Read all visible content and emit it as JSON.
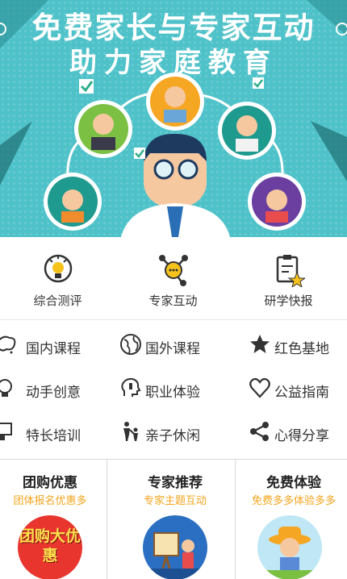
{
  "banner": {
    "title_line1": "免费家长与专家互动",
    "title_line2": "助力家庭教育",
    "colors": {
      "bg": "#4fc2c9",
      "ring": "#ffffff",
      "orange": "#f5a623",
      "green": "#7bc043"
    }
  },
  "quick_links": [
    {
      "label": "综合测评",
      "icon": "assessment-icon"
    },
    {
      "label": "专家互动",
      "icon": "expert-chat-icon"
    },
    {
      "label": "研学快报",
      "icon": "report-star-icon"
    }
  ],
  "categories": [
    {
      "label": "国内课程",
      "icon": "china-map-icon"
    },
    {
      "label": "国外课程",
      "icon": "globe-icon"
    },
    {
      "label": "红色基地",
      "icon": "star-icon"
    },
    {
      "label": "动手创意",
      "icon": "lightbulb-icon"
    },
    {
      "label": "职业体验",
      "icon": "person-head-icon"
    },
    {
      "label": "公益指南",
      "icon": "heart-icon"
    },
    {
      "label": "特长培训",
      "icon": "presentation-icon"
    },
    {
      "label": "亲子休闲",
      "icon": "parent-child-icon"
    },
    {
      "label": "心得分享",
      "icon": "share-icon"
    }
  ],
  "cards": [
    {
      "title": "团购优惠",
      "subtitle": "团体报名优惠多",
      "image_text": "团购大优惠"
    },
    {
      "title": "专家推荐",
      "subtitle": "专家主题互动"
    },
    {
      "title": "免费体验",
      "subtitle": "免费多多体验多多"
    }
  ],
  "accent_color": "#f4a51d"
}
